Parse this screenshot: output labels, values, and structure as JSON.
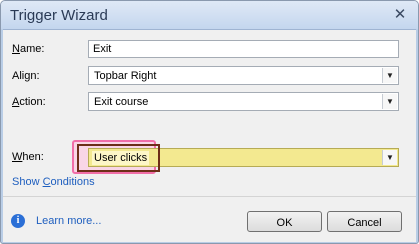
{
  "window": {
    "title": "Trigger Wizard",
    "close_glyph": "✕"
  },
  "form": {
    "name": {
      "label_key": "N",
      "label_rest": "ame:",
      "value": "Exit"
    },
    "align": {
      "label_pre": "Ali",
      "label_key": "g",
      "label_rest": "n:",
      "value": "Topbar Right"
    },
    "action": {
      "label_key": "A",
      "label_rest": "ction:",
      "value": "Exit course"
    },
    "when": {
      "label_key": "W",
      "label_rest": "hen:",
      "value": "User clicks"
    },
    "show_conditions_pre": "Show ",
    "show_conditions_key": "C",
    "show_conditions_rest": "onditions"
  },
  "footer": {
    "info_glyph": "i",
    "learn_more": "Learn more...",
    "ok_label": "OK",
    "cancel_label": "Cancel"
  },
  "icons": {
    "dropdown_arrow": "▼"
  },
  "colors": {
    "highlight": "#f3e990",
    "link": "#1f5fbf",
    "callout_border": "#6d2d18"
  }
}
